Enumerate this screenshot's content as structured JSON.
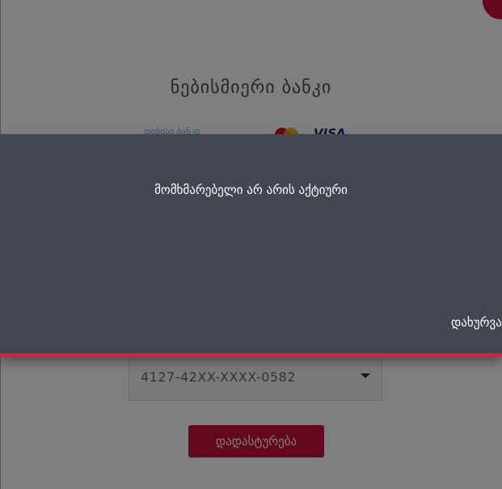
{
  "page": {
    "bank_title": "ნებისმიერი ბანკი",
    "logos": {
      "tbc_text": "თიბისი ბანკი",
      "visa_text": "VISA"
    },
    "card_select": {
      "value": "4127-42XX-XXXX-0582"
    },
    "confirm_label": "დადასტურება"
  },
  "dialog": {
    "message": "მომხმარებელი არ არის აქტიური",
    "close_label": "დახურვა"
  },
  "colors": {
    "accent": "#c8103d",
    "dialog_bg": "#414650",
    "dialog_border": "#e01e3c"
  },
  "icons": {
    "dropdown": "chevron-down-icon",
    "mastercard": "mastercard-logo",
    "visa": "visa-logo"
  }
}
